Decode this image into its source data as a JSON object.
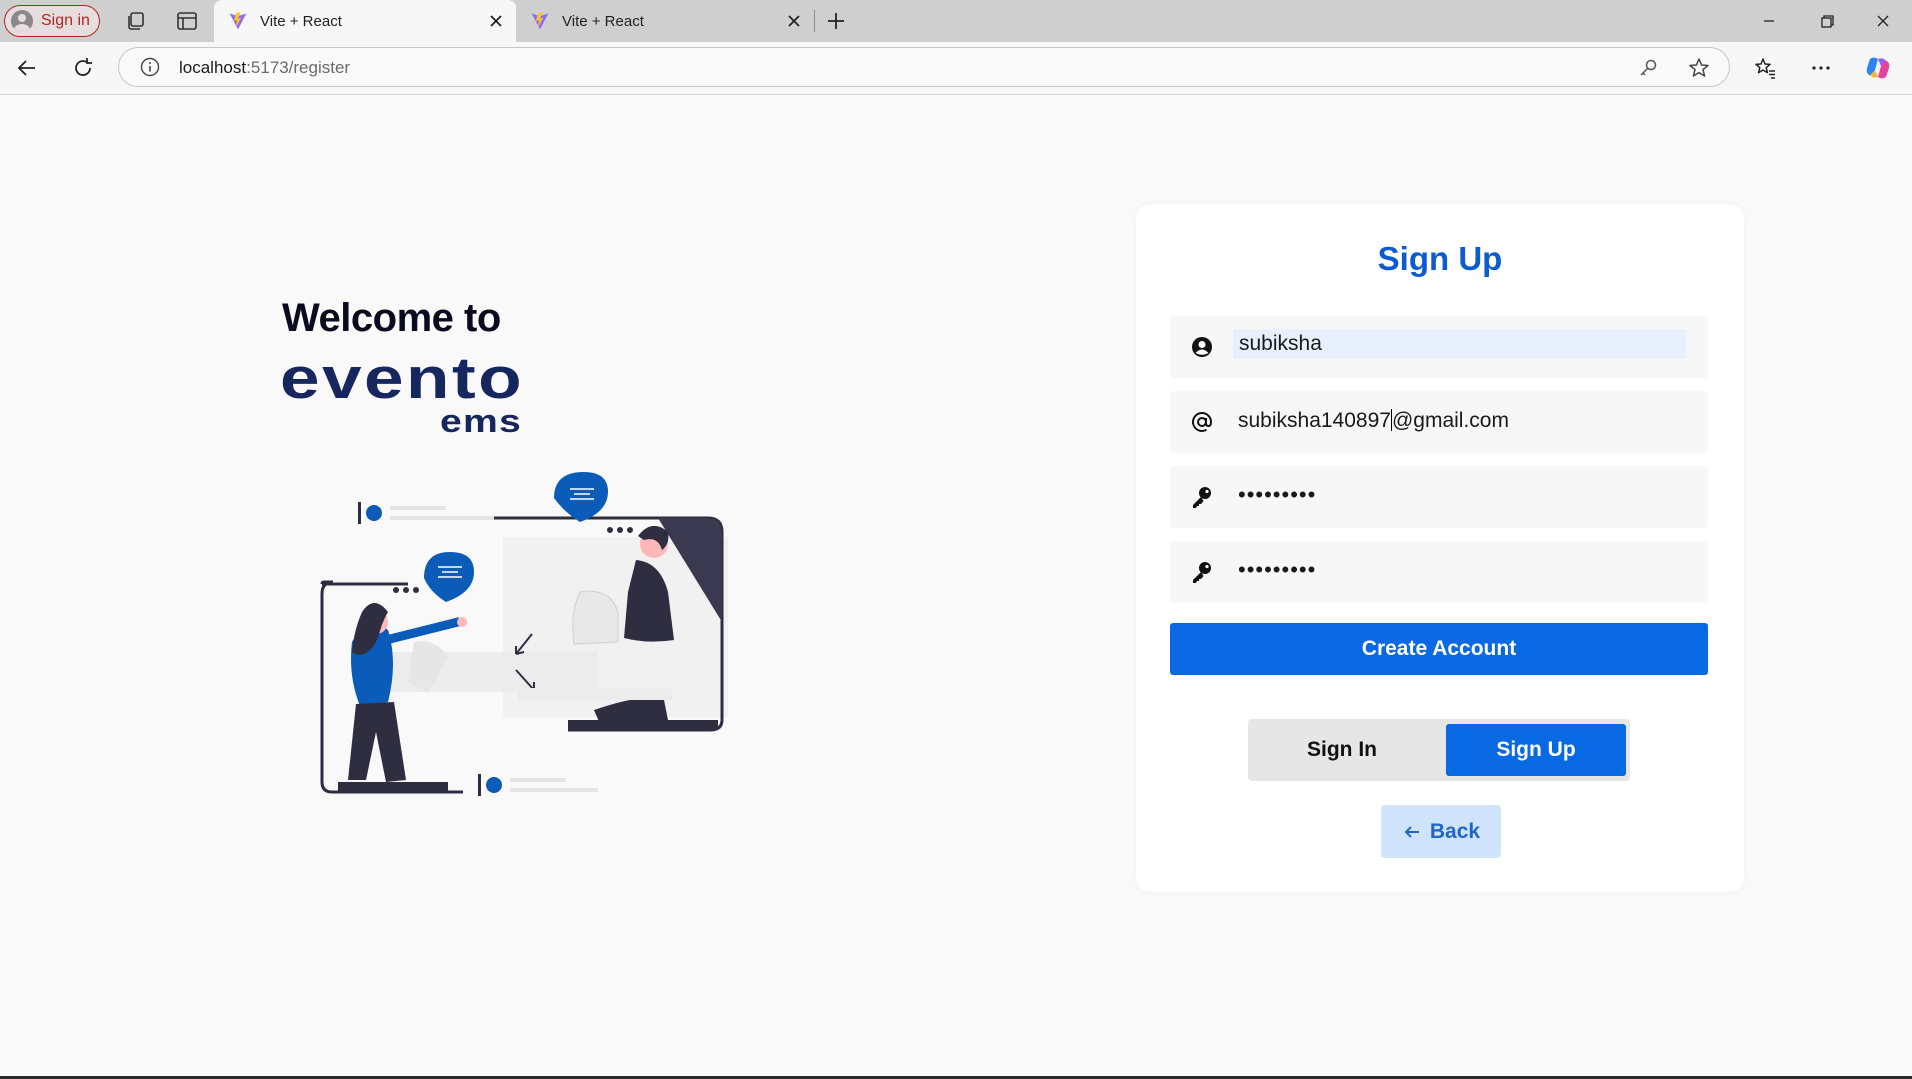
{
  "browser": {
    "profile_label": "Sign in",
    "tabs": [
      {
        "title": "Vite + React",
        "active": true
      },
      {
        "title": "Vite + React",
        "active": false
      }
    ],
    "url_host": "localhost",
    "url_path": ":5173/register"
  },
  "left": {
    "welcome": "Welcome to",
    "logo_primary": "evento",
    "logo_secondary": "ems"
  },
  "form": {
    "title": "Sign Up",
    "username": "subiksha",
    "email_before_caret": "subiksha140897",
    "email_after_caret": "@gmail.com",
    "password_mask": "•••••••••",
    "confirm_mask": "•••••••••",
    "create_label": "Create Account",
    "toggle_signin": "Sign In",
    "toggle_signup": "Sign Up",
    "back_label": "Back"
  },
  "colors": {
    "primary": "#0869e3",
    "title": "#0b5bd1",
    "logo": "#16265e",
    "illustration_blue": "#0b5bb8",
    "back_bg": "#cfe3fb"
  },
  "icons": {
    "user": "user-circle-icon",
    "email": "at-sign-icon",
    "password": "key-icon",
    "back": "arrow-left-icon"
  }
}
